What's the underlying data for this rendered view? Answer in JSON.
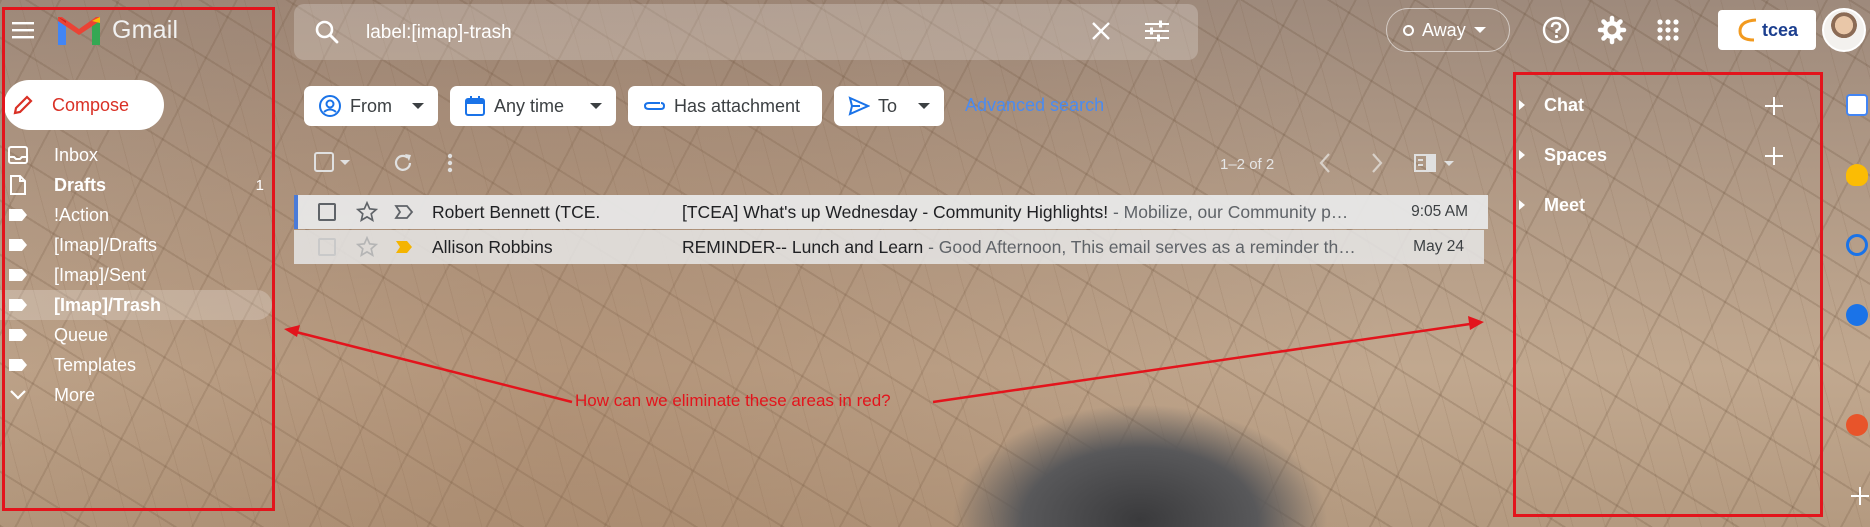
{
  "app": {
    "name": "Gmail"
  },
  "search": {
    "query": "label:[imap]-trash"
  },
  "header": {
    "status_label": "Away",
    "org_logo_text": "tcea"
  },
  "nav": {
    "compose_label": "Compose",
    "items": [
      {
        "label": "Inbox",
        "count": ""
      },
      {
        "label": "Drafts",
        "count": "1"
      },
      {
        "label": "!Action",
        "count": ""
      },
      {
        "label": "[Imap]/Drafts",
        "count": ""
      },
      {
        "label": "[Imap]/Sent",
        "count": ""
      },
      {
        "label": "[Imap]/Trash",
        "count": ""
      },
      {
        "label": "Queue",
        "count": ""
      },
      {
        "label": "Templates",
        "count": ""
      },
      {
        "label": "More",
        "count": ""
      }
    ]
  },
  "filters": {
    "from": "From",
    "any_time": "Any time",
    "has_attachment": "Has attachment",
    "to": "To",
    "advanced_search": "Advanced search"
  },
  "toolbar": {
    "pagination": "1–2 of 2"
  },
  "emails": [
    {
      "sender": "Robert Bennett (TCE.",
      "subject": "[TCEA] What's up Wednesday - Community Highlights!",
      "snippet": " - Mobilize, our Community p…",
      "date": "9:05 AM"
    },
    {
      "sender": "Allison Robbins",
      "subject": "REMINDER-- Lunch and Learn",
      "snippet": " - Good Afternoon, This email serves as a reminder th…",
      "date": "May 24"
    }
  ],
  "right_panel": {
    "chat": "Chat",
    "spaces": "Spaces",
    "meet": "Meet"
  },
  "side_apps": [
    "calendar-icon",
    "keep-icon",
    "tasks-icon",
    "contacts-icon",
    "addon-icon",
    "add-icon"
  ],
  "annotation": {
    "text": "How can we eliminate these areas in red?",
    "color": "#e3141c"
  },
  "colors": {
    "compose_text": "#d93025",
    "link_blue": "#4b8bf0",
    "selected_row_accent": "#4a7bd8"
  }
}
